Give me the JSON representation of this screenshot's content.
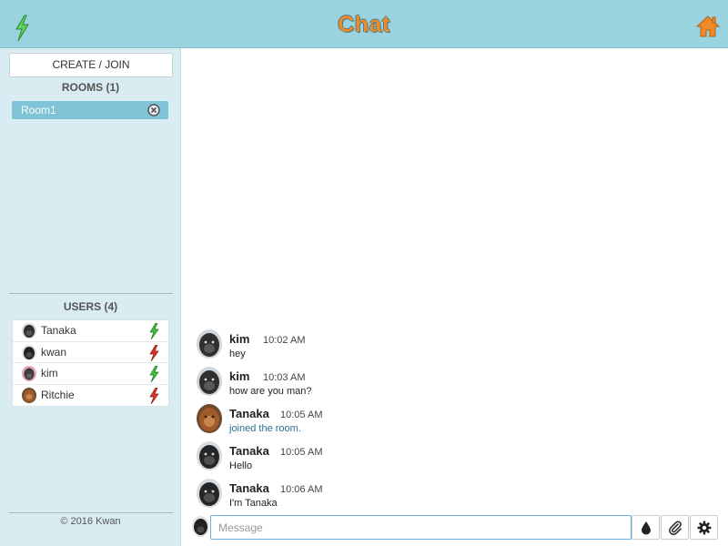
{
  "header": {
    "title": "Chat",
    "logo_icon": "lightning-bolt-icon",
    "home_icon": "home-icon",
    "accent_color": "#f08a28",
    "bar_color": "#99d3df"
  },
  "sidebar": {
    "create_label": "CREATE / JOIN",
    "rooms_title": "ROOMS (1)",
    "rooms": [
      {
        "name": "Room1",
        "close_icon": "close-circle-icon"
      }
    ],
    "users_title": "USERS (4)",
    "users": [
      {
        "name": "Tanaka",
        "status": "online",
        "status_icon": "lightning-bolt-icon",
        "status_color": "#3fc13f"
      },
      {
        "name": "kwan",
        "status": "offline",
        "status_icon": "lightning-bolt-icon",
        "status_color": "#d9342b"
      },
      {
        "name": "kim",
        "status": "online",
        "status_icon": "lightning-bolt-icon",
        "status_color": "#3fc13f"
      },
      {
        "name": "Ritchie",
        "status": "offline",
        "status_icon": "lightning-bolt-icon",
        "status_color": "#d9342b"
      }
    ],
    "footer": "© 2016 Kwan"
  },
  "messages": [
    {
      "author": "kim",
      "time": "10:02 AM",
      "text": "hey",
      "system": false
    },
    {
      "author": "kim",
      "time": "10:03 AM",
      "text": "how are you man?",
      "system": false
    },
    {
      "author": "Tanaka",
      "time": "10:05 AM",
      "text": "joined the room.",
      "system": true
    },
    {
      "author": "Tanaka",
      "time": "10:05 AM",
      "text": "Hello",
      "system": false
    },
    {
      "author": "Tanaka",
      "time": "10:06 AM",
      "text": "I'm Tanaka",
      "system": false
    }
  ],
  "composer": {
    "placeholder": "Message",
    "value": "",
    "tools": [
      "drop-icon",
      "paperclip-icon",
      "gear-icon"
    ]
  }
}
